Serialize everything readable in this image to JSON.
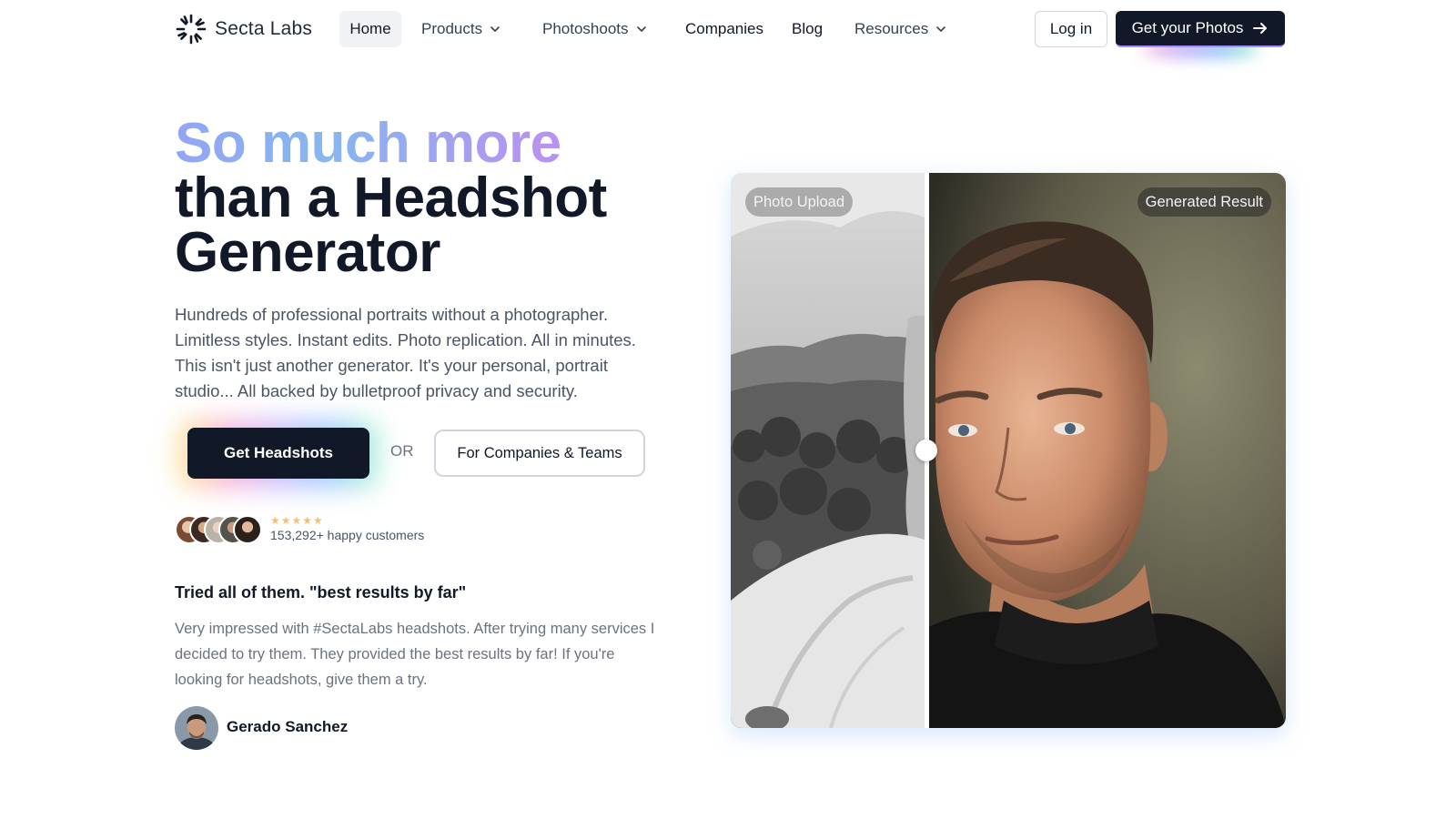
{
  "nav": {
    "brand": "Secta Labs",
    "items": [
      {
        "label": "Home",
        "dropdown": false
      },
      {
        "label": "Products",
        "dropdown": true
      },
      {
        "label": "Photoshoots",
        "dropdown": true
      },
      {
        "label": "Companies",
        "dropdown": false
      },
      {
        "label": "Blog",
        "dropdown": false
      },
      {
        "label": "Resources",
        "dropdown": true
      }
    ],
    "login_label": "Log in",
    "cta_label": "Get your Photos"
  },
  "hero": {
    "title_gradient": "So much more",
    "title_line2": "than a Headshot",
    "title_line3": "Generator",
    "description": "Hundreds of professional portraits without a photographer. Limitless styles. Instant edits. Photo replication. All in minutes. This isn't just another generator. It's your personal, portrait studio... All backed by bulletproof privacy and security.",
    "cta_primary": "Get Headshots",
    "or_label": "OR",
    "cta_secondary": "For Companies & Teams",
    "rating_stars": "★★★★★",
    "customers_text": "153,292+ happy customers"
  },
  "testimonial": {
    "title": "Tried all of them. \"best results by far\"",
    "body": "Very impressed with #SectaLabs headshots. After trying many services I decided to try them. They provided the best results by far! If you're looking for headshots, give them a try.",
    "author": "Gerado Sanchez"
  },
  "comparison": {
    "left_label": "Photo Upload",
    "right_label": "Generated Result"
  },
  "colors": {
    "brand_dark": "#111827",
    "title_gradient_start": "#93a5f3",
    "title_gradient_end": "#c98cf0",
    "star": "#f4c070"
  },
  "icons": [
    "logo-mark-icon",
    "chevron-down-icon",
    "arrow-right-icon"
  ]
}
